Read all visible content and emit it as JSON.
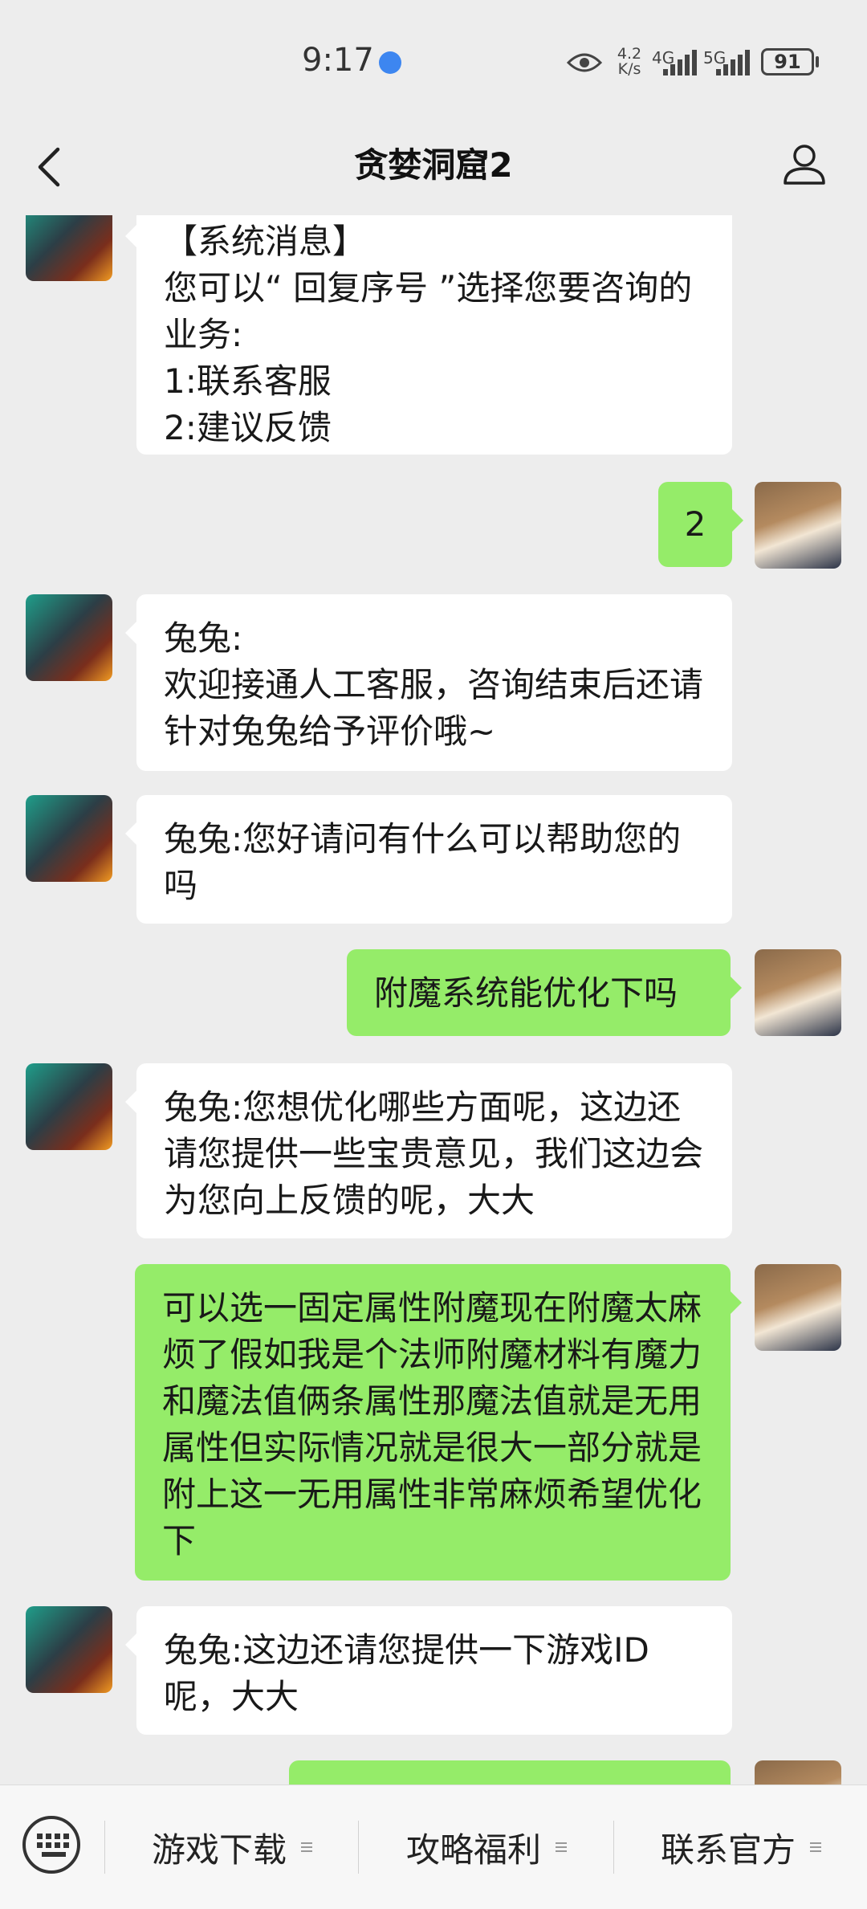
{
  "status": {
    "time": "9:17",
    "speed_value": "4.2",
    "speed_unit": "K/s",
    "net1": "4G",
    "net2": "5G",
    "battery": "91"
  },
  "header": {
    "title": "贪婪洞窟2"
  },
  "messages": [
    {
      "sender": "bot",
      "text": "【系统消息】\n您可以“ 回复序号 ”选择您要咨询的业务:\n1:联系客服\n2:建议反馈"
    },
    {
      "sender": "user",
      "text": "2"
    },
    {
      "sender": "bot",
      "text": "兔兔:\n欢迎接通人工客服，咨询结束后还请针对兔兔给予评价哦~"
    },
    {
      "sender": "bot",
      "text": "兔兔:您好请问有什么可以帮助您的吗"
    },
    {
      "sender": "user",
      "text": "附魔系统能优化下吗"
    },
    {
      "sender": "bot",
      "text": "兔兔:您想优化哪些方面呢，这边还请您提供一些宝贵意见，我们这边会为您向上反馈的呢，大大"
    },
    {
      "sender": "user",
      "text": "可以选一固定属性附魔现在附魔太麻烦了假如我是个法师附魔材料有魔力和魔法值俩条属性那魔法值就是无用属性但实际情况就是很大一部分就是附上这一无用属性非常麻烦希望优化下"
    },
    {
      "sender": "bot",
      "text": "兔兔:这边还请您提供一下游戏ID呢，大大"
    },
    {
      "sender": "user",
      "text": ""
    }
  ],
  "bottom_menu": {
    "items": [
      {
        "label": "游戏下载"
      },
      {
        "label": "攻略福利"
      },
      {
        "label": "联系官方"
      }
    ]
  }
}
